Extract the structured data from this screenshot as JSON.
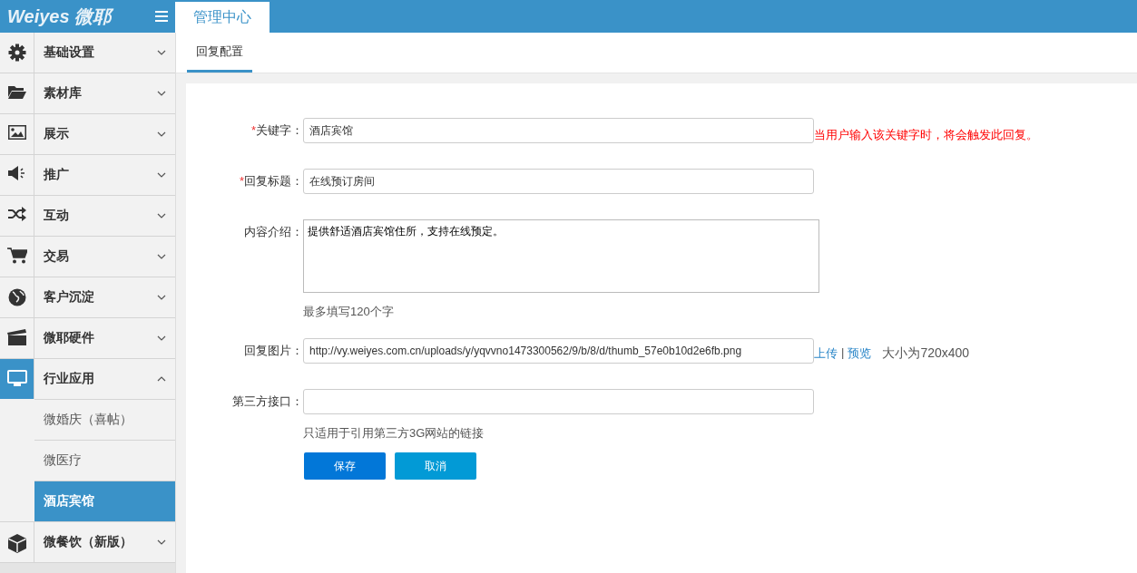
{
  "logo": {
    "text": "Weiyes 微耶"
  },
  "header_tabs": [
    {
      "label": "管理中心",
      "selected": true
    }
  ],
  "sidebar": {
    "items": [
      {
        "label": "基础设置",
        "expanded": false,
        "selected": false
      },
      {
        "label": "素材库",
        "expanded": false,
        "selected": false
      },
      {
        "label": "展示",
        "expanded": false,
        "selected": false
      },
      {
        "label": "推广",
        "expanded": false,
        "selected": false
      },
      {
        "label": "互动",
        "expanded": false,
        "selected": false
      },
      {
        "label": "交易",
        "expanded": false,
        "selected": false
      },
      {
        "label": "客户沉淀",
        "expanded": false,
        "selected": false
      },
      {
        "label": "微耶硬件",
        "expanded": false,
        "selected": false
      },
      {
        "label": "行业应用",
        "expanded": true,
        "selected": true,
        "children": [
          {
            "label": "微婚庆（喜帖）",
            "selected": false
          },
          {
            "label": "微医疗",
            "selected": false
          },
          {
            "label": "酒店宾馆",
            "selected": true
          }
        ]
      },
      {
        "label": "微餐饮（新版）",
        "expanded": false,
        "selected": false
      }
    ]
  },
  "sub_tabs": [
    {
      "label": "回复配置",
      "selected": true
    }
  ],
  "form": {
    "fields": [
      {
        "kind": "input",
        "required_mark": "*",
        "label": "关键字：",
        "value": "酒店宾馆",
        "side_note": "当用户输入该关键字时，将会触发此回复。"
      },
      {
        "kind": "input",
        "required_mark": "*",
        "label": "回复标题：",
        "value": "在线预订房间"
      },
      {
        "kind": "textarea",
        "label": "内容介绍：",
        "value": "提供舒适酒店宾馆住所，支持在线预定。",
        "hint": "最多填写120个字"
      },
      {
        "kind": "image",
        "label": "回复图片：",
        "value": "http://vy.weiyes.com.cn/uploads/y/yqvvno1473300562/9/b/8/d/thumb_57e0b10d2e6fb.png",
        "links": [
          "上传",
          "|",
          "预览"
        ],
        "size_note": "大小为720x400"
      },
      {
        "kind": "input",
        "label": "第三方接口：",
        "hint": "只适用于引用第三方3G网站的链接"
      }
    ],
    "buttons": [
      {
        "label": "保存",
        "kind": "primary"
      },
      {
        "label": "取消",
        "kind": "secondary"
      }
    ]
  }
}
